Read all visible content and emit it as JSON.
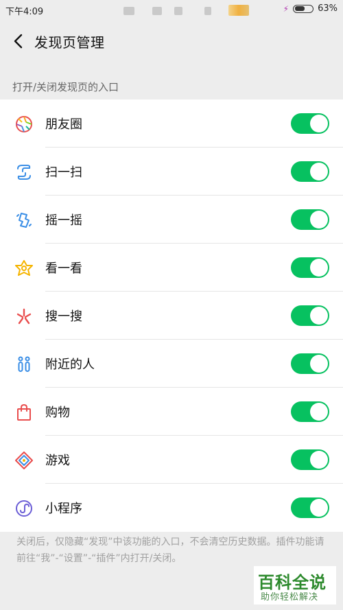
{
  "status": {
    "time": "下午4:09",
    "battery": "63%",
    "battery_level": 0.63
  },
  "nav": {
    "title": "发现页管理",
    "back_icon": "chevron-left-icon"
  },
  "section": {
    "header": "打开/关闭发现页的入口"
  },
  "items": [
    {
      "label": "朋友圈",
      "icon": "moments-icon",
      "enabled": true
    },
    {
      "label": "扫一扫",
      "icon": "scan-icon",
      "enabled": true
    },
    {
      "label": "摇一摇",
      "icon": "shake-icon",
      "enabled": true
    },
    {
      "label": "看一看",
      "icon": "top-stories-icon",
      "enabled": true
    },
    {
      "label": "搜一搜",
      "icon": "search-icon",
      "enabled": true
    },
    {
      "label": "附近的人",
      "icon": "people-nearby-icon",
      "enabled": true
    },
    {
      "label": "购物",
      "icon": "shopping-bag-icon",
      "enabled": true
    },
    {
      "label": "游戏",
      "icon": "games-icon",
      "enabled": true
    },
    {
      "label": "小程序",
      "icon": "mini-program-icon",
      "enabled": true
    }
  ],
  "footer": {
    "note": "关闭后，仅隐藏“发现”中该功能的入口，不会清空历史数据。插件功能请前往“我”-“设置”-“插件”内打开/关闭。"
  },
  "watermark": {
    "main": "百科全说",
    "sub": "助你轻松解决"
  },
  "colors": {
    "toggle_on": "#07c160",
    "background": "#ededed"
  }
}
